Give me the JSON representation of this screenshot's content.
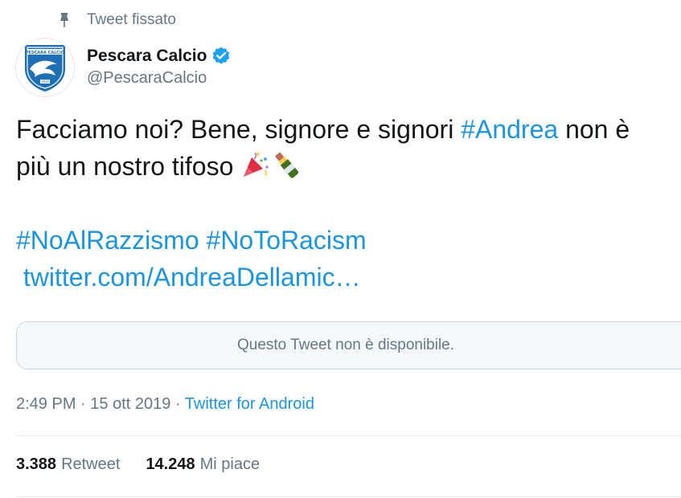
{
  "pinned": {
    "label": "Tweet fissato",
    "icon": "pin-icon"
  },
  "author": {
    "name": "Pescara Calcio",
    "handle": "@PescaraCalcio",
    "verified": true,
    "avatar_text": "PESCARA CALCIO",
    "avatar_year": "1936"
  },
  "tweet": {
    "text_1": "Facciamo noi? Bene, signore e signori ",
    "hashtag_1": "#Andrea",
    "text_2": " non è",
    "text_3": "più un nostro tifoso ",
    "emoji": [
      "party-popper-icon",
      "champagne-bottle-icon"
    ],
    "hashtag_2": "#NoAlRazzismo",
    "hashtag_3": "#NoToRacism",
    "link": "twitter.com/AndreaDellamic…"
  },
  "quoted": {
    "unavailable_text": "Questo Tweet non è disponibile."
  },
  "meta": {
    "time": "2:49 PM",
    "separator": " · ",
    "date": "15 ott 2019",
    "source": "Twitter for Android"
  },
  "stats": {
    "retweets_count": "3.388",
    "retweets_label": "Retweet",
    "likes_count": "14.248",
    "likes_label": "Mi piace"
  },
  "colors": {
    "link": "#1b95e0",
    "secondary_text": "#657786",
    "primary_text": "#14171a",
    "verified": "#1da1f2",
    "brand_blue": "#1f6fb5"
  }
}
